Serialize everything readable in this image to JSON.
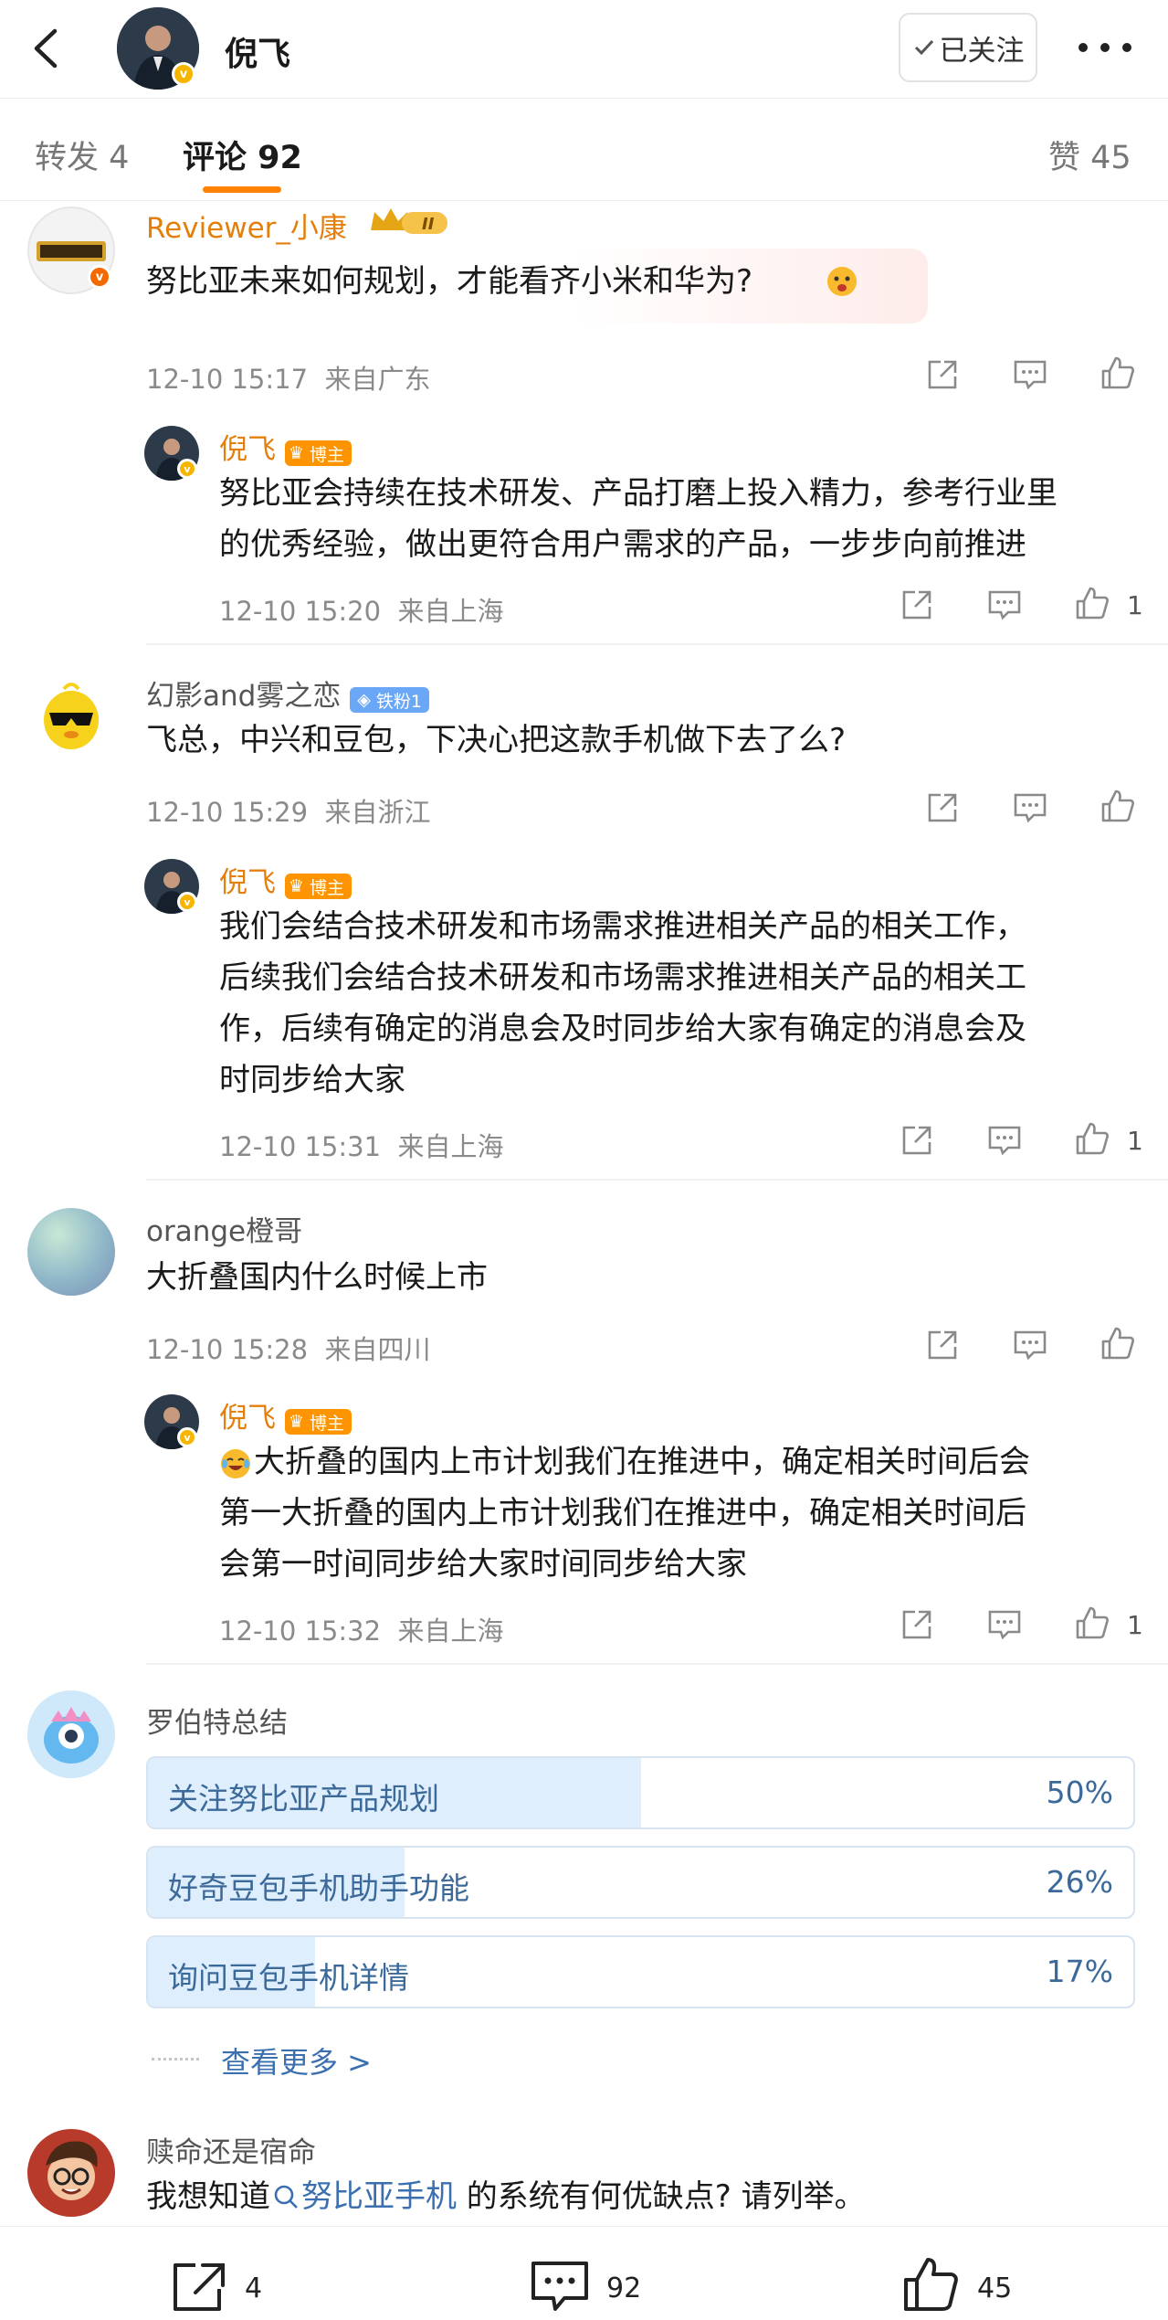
{
  "header": {
    "name": "倪飞",
    "follow_label": "已关注",
    "follow_icon": "check-icon",
    "more_icon": "more-dots-icon",
    "back_icon": "back-arrow-icon"
  },
  "tabs": {
    "repost": "转发 4",
    "comments": "评论 92",
    "likes": "赞 45"
  },
  "comments": [
    {
      "user": "Reviewer_小康",
      "text": "努比亚未来如何规划，才能看齐小米和华为?",
      "time": "12-10 15:17",
      "location": "来自广东",
      "reply": {
        "user": "倪飞",
        "badge": "博主",
        "text_lines": [
          "努比亚会持续在技术研发、产品打磨上投入精力，参考行业里",
          "的优秀经验，做出更符合用户需求的产品，一步步向前推进"
        ],
        "time": "12-10 15:20",
        "location": "来自上海",
        "likes": "1"
      }
    },
    {
      "user": "幻影and雾之恋",
      "badge": "铁粉1",
      "text": "飞总，中兴和豆包，下决心把这款手机做下去了么?",
      "time": "12-10 15:29",
      "location": "来自浙江",
      "reply": {
        "user": "倪飞",
        "badge": "博主",
        "text_lines": [
          "我们会结合技术研发和市场需求推进相关产品的相关工作，",
          "后续我们会结合技术研发和市场需求推进相关产品的相关工",
          "作，后续有确定的消息会及时同步给大家有确定的消息会及",
          "时同步给大家"
        ],
        "time": "12-10 15:31",
        "location": "来自上海",
        "likes": "1"
      }
    },
    {
      "user": "orange橙哥",
      "text": "大折叠国内什么时候上市",
      "time": "12-10 15:28",
      "location": "来自四川",
      "reply": {
        "user": "倪飞",
        "badge": "博主",
        "text_lines": [
          "大折叠的国内上市计划我们在推进中，确定相关时间后会",
          "第一大折叠的国内上市计划我们在推进中，确定相关时间后",
          "会第一时间同步给大家时间同步给大家"
        ],
        "time": "12-10 15:32",
        "location": "来自上海",
        "likes": "1"
      }
    }
  ],
  "summary": {
    "user": "罗伯特总结",
    "options": [
      {
        "label": "关注努比亚产品规划",
        "pct": "50%",
        "fraction": 0.5
      },
      {
        "label": "好奇豆包手机助手功能",
        "pct": "26%",
        "fraction": 0.26
      },
      {
        "label": "询问豆包手机详情",
        "pct": "17%",
        "fraction": 0.17
      }
    ],
    "more": "查看更多 >"
  },
  "last_comment": {
    "user": "赎命还是宿命",
    "prefix": "我想知道",
    "link": "努比亚手机",
    "suffix": " 的系统有何优缺点? 请列举。"
  },
  "bottom": {
    "repost": "4",
    "comments": "92",
    "likes": "45"
  },
  "colors": {
    "accent": "#ff8200",
    "gold_name": "#e47f0c",
    "poll_text": "#3b6a9a",
    "link": "#3b6fb0"
  }
}
